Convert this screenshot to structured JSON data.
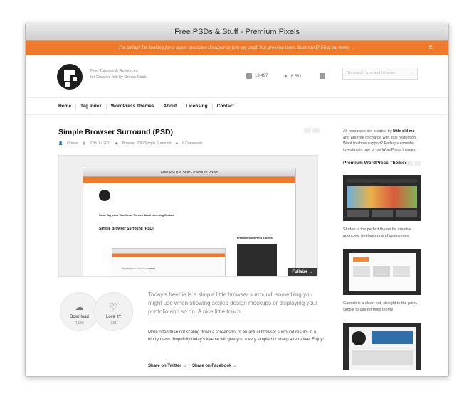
{
  "window": {
    "title": "Free PSDs & Stuff - Premium Pixels"
  },
  "hire_bar": {
    "message": "I'm hiring! I'm looking for a super-awesome designer to join my small but growing team. Interested?",
    "link": "Find out more →",
    "close": "×"
  },
  "header": {
    "tagline_line1": "Free Tutorials & Resources",
    "tagline_line2": "for Creative folk by Orman Clark",
    "rss_count": "19,497",
    "twitter_count": "6,531",
    "search_placeholder": "To search type and hit enter",
    "search_arrow": "→"
  },
  "nav": {
    "items": [
      "Home",
      "Tag Index",
      "WordPress Themes",
      "About",
      "Licensing",
      "Contact"
    ]
  },
  "post": {
    "title": "Simple Browser Surround (PSD)",
    "author": "Orman",
    "date": "27th Jul 2011",
    "tags": "Browser  PSD  Simple  Surround",
    "comments": "6 Comments",
    "preview_window_title": "Free PSDs & Stuff - Premium Pixels",
    "preview_post_title": "Simple Browser Surround (PSD)",
    "preview_inner_title": "Simple Browser Surround (PSD)",
    "preview_sidebar_head": "Premium WordPress Themes",
    "fullsize": "Fullsize →",
    "download_label": "Download",
    "download_count": "4,136",
    "love_label": "Love it?",
    "love_count": "331",
    "lead": "Today's freebie is a simple little browser surround, something you might use when showing scaled design mockups or displaying your portfolio and so on. A nice little touch.",
    "body": "More often than not scaling down a screenshot of an actual browser surround results in a blurry mess. Hopefully today's freebie will give you a very simple but sharp alternative. Enjoy!",
    "share_twitter": "Share on Twitter →",
    "share_facebook": "Share on Facebook →"
  },
  "sidebar": {
    "intro_a": "All resources are created by",
    "intro_bold": "little old me",
    "intro_b": "and are free of charge with little restriction. Want to show support? Perhaps consider investing in one of my WordPress themes.",
    "heading": "Premium WordPress Themes",
    "themes": [
      {
        "caption": "Studeo is the perfect theme for creative agencies, freelancers and businesses."
      },
      {
        "caption": "Garnish is a clean-cut, straight to the point, simple to use portfolio theme."
      }
    ]
  },
  "colors": {
    "accent": "#f07a2b",
    "dark": "#1e1e1e"
  }
}
